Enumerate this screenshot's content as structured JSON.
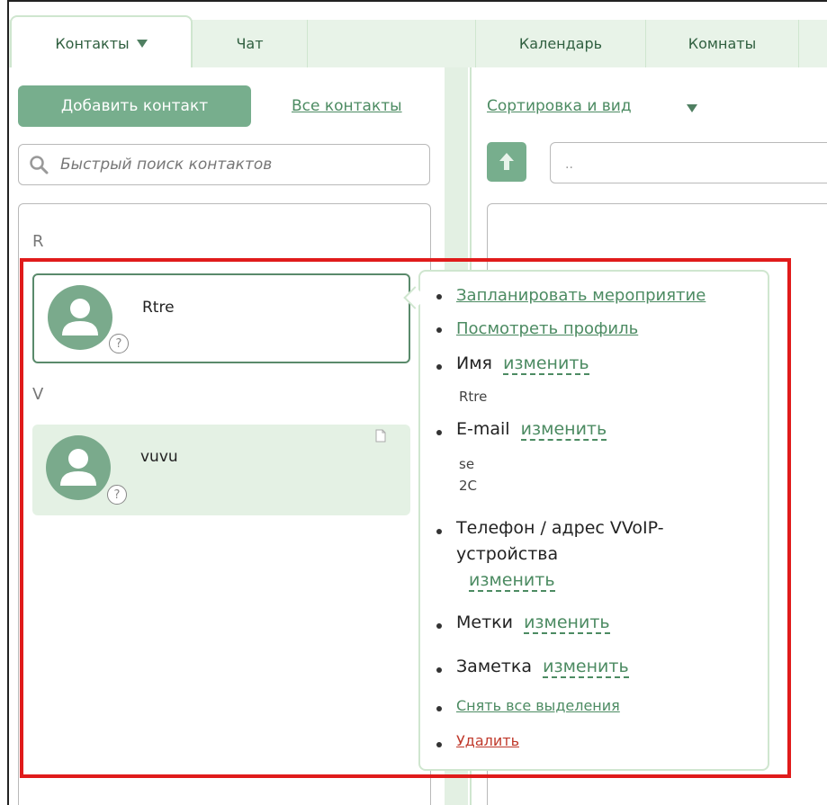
{
  "tabs": {
    "contacts": "Контакты",
    "chat": "Чат",
    "calendar": "Календарь",
    "rooms": "Комнаты"
  },
  "left": {
    "add_contact": "Добавить контакт",
    "all_contacts": "Все контакты",
    "search_placeholder": "Быстрый поиск контактов"
  },
  "right": {
    "sort_view": "Сортировка и вид",
    "path_value": ".."
  },
  "groups": [
    {
      "letter": "R",
      "contacts": [
        {
          "name": "Rtre",
          "status_icon": "question-icon"
        }
      ]
    },
    {
      "letter": "V",
      "contacts": [
        {
          "name": "vuvu",
          "status_icon": "question-icon"
        }
      ]
    }
  ],
  "popup": {
    "schedule": "Запланировать мероприятие",
    "view_profile": "Посмотреть профиль",
    "name_label": "Имя",
    "name_value": "Rtre",
    "email_label": "E-mail",
    "email_value_1": "se",
    "email_value_2": "2C",
    "phone_label_1": "Телефон / адрес VVoIP-",
    "phone_label_2": "устройства",
    "tags_label": "Метки",
    "note_label": "Заметка",
    "edit": "изменить",
    "deselect_all": "Снять все выделения",
    "delete": "Удалить"
  },
  "colors": {
    "accent": "#77ae8d",
    "link": "#4c8b62",
    "delete": "#c0392b",
    "highlight_box": "#e01b1b"
  }
}
